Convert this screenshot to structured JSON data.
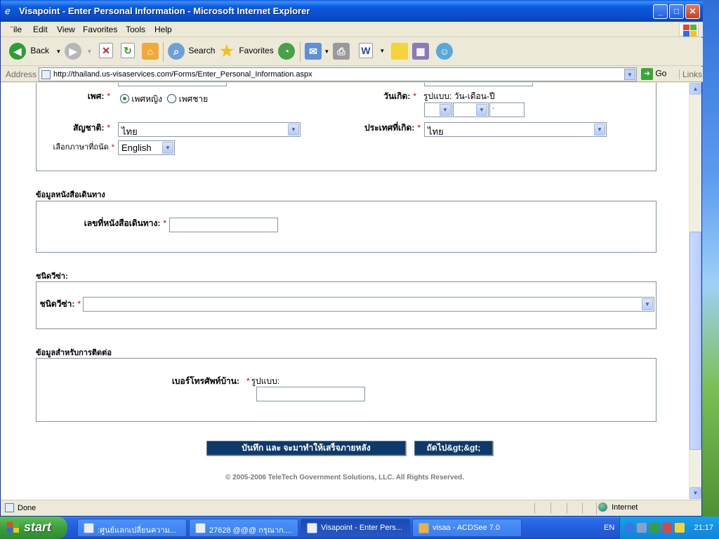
{
  "window": {
    "title": "Visapoint - Enter Personal Information - Microsoft Internet Explorer"
  },
  "menu": [
    "¨ile",
    "Edit",
    "View",
    "Favorites",
    "Tools",
    "Help"
  ],
  "toolbar": {
    "back": "Back",
    "search": "Search",
    "favorites": "Favorites"
  },
  "address": {
    "label": "Address",
    "url": "http://thailand.us-visaservices.com/Forms/Enter_Personal_Information.aspx",
    "go": "Go",
    "links": "Links"
  },
  "form": {
    "gender": {
      "label": "เพศ:",
      "female": "เพศหญิง",
      "male": "เพศชาย",
      "selected": "female"
    },
    "dob": {
      "label": "วันเกิด:",
      "format": "รูปแบบ: วัน-เดือน-ปี",
      "year": "."
    },
    "nationality": {
      "label": "สัญชาติ:",
      "value": "ไทย"
    },
    "birth_country": {
      "label": "ประเทศที่เกิด:",
      "value": "ไทย"
    },
    "language": {
      "label": "เลือกภาษาที่ถนัด",
      "value": "English"
    },
    "passport_section": "ข้อมูลหนังสือเดินทาง",
    "passport_number": {
      "label": "เลขที่หนังสือเดินทาง:",
      "value": ""
    },
    "visa_section": "ชนิดวีซ่า:",
    "visa_type": {
      "label": "ชนิดวีซ่า:",
      "value": ""
    },
    "contact_section": "ข้อมูลสำหรับการติดต่อ",
    "home_phone": {
      "label": "เบอร์โทรศัพท์บ้าน:",
      "format": "รูปแบบ:",
      "value": ""
    },
    "required_mark": "*",
    "save_button": "บันทึก และ จะมาทำให้เสร็จภายหลัง",
    "next_button": "ถัดไป&gt;&gt;",
    "footer": "© 2005-2006 TeleTech Government Solutions, LLC. All Rights Reserved."
  },
  "status": {
    "text": "Done",
    "zone": "Internet"
  },
  "taskbar": {
    "start": "start",
    "tasks": [
      {
        "label": ":ศูนย์แลกเปลี่ยนความ...",
        "active": false
      },
      {
        "label": "27628 @@@ กรุณาก....",
        "active": false
      },
      {
        "label": "Visapoint - Enter Pers...",
        "active": true
      },
      {
        "label": "visaa - ACDSee 7.0",
        "active": false
      }
    ],
    "language": "EN",
    "clock": "21:17"
  }
}
